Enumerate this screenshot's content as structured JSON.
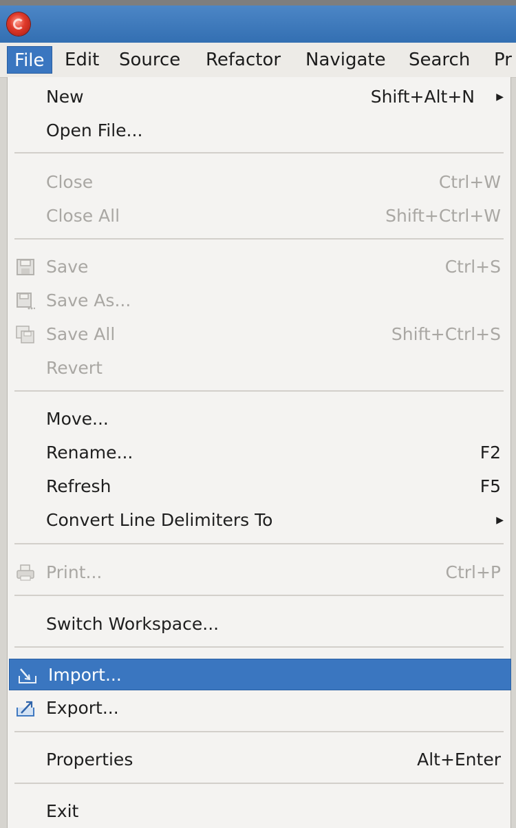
{
  "menubar": {
    "items": [
      "File",
      "Edit",
      "Source",
      "Refactor",
      "Navigate",
      "Search",
      "Pr"
    ]
  },
  "file_menu": {
    "new": {
      "label": "New",
      "accel": "Shift+Alt+N"
    },
    "open_file": {
      "label": "Open File..."
    },
    "close": {
      "label": "Close",
      "accel": "Ctrl+W"
    },
    "close_all": {
      "label": "Close All",
      "accel": "Shift+Ctrl+W"
    },
    "save": {
      "label": "Save",
      "accel": "Ctrl+S"
    },
    "save_as": {
      "label": "Save As..."
    },
    "save_all": {
      "label": "Save All",
      "accel": "Shift+Ctrl+S"
    },
    "revert": {
      "label": "Revert"
    },
    "move": {
      "label": "Move..."
    },
    "rename": {
      "label": "Rename...",
      "accel": "F2"
    },
    "refresh": {
      "label": "Refresh",
      "accel": "F5"
    },
    "convert": {
      "label": "Convert Line Delimiters To"
    },
    "print": {
      "label": "Print...",
      "accel": "Ctrl+P"
    },
    "switch_workspace": {
      "label": "Switch Workspace..."
    },
    "import": {
      "label": "Import..."
    },
    "export": {
      "label": "Export..."
    },
    "properties": {
      "label": "Properties",
      "accel": "Alt+Enter"
    },
    "exit": {
      "label": "Exit"
    }
  },
  "colors": {
    "titlebar": "#3d7bbd",
    "highlight": "#3a76c0",
    "menu_bg": "#f4f3f1",
    "disabled_text": "#a9a7a3"
  },
  "icons": [
    "app-logo-icon",
    "submenu-arrow-icon",
    "save-disk-icon",
    "save-as-disk-icon",
    "save-all-disks-icon",
    "printer-icon",
    "import-icon",
    "export-icon"
  ]
}
